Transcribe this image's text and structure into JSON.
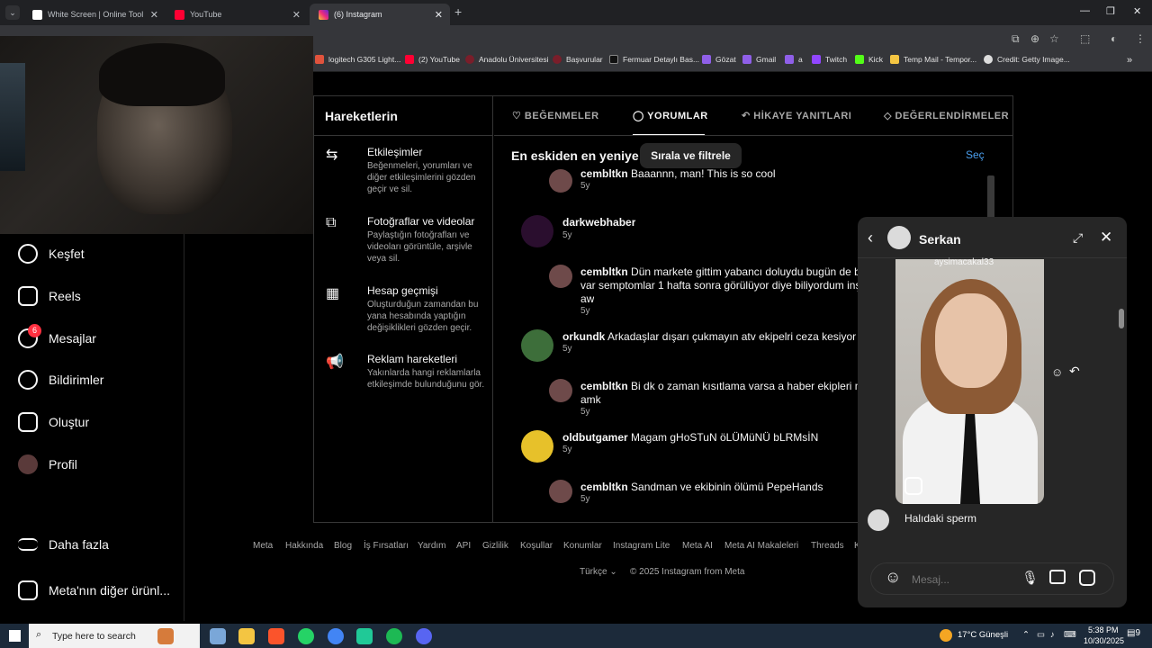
{
  "browser": {
    "tabs": [
      {
        "label": "White Screen | Online Tool",
        "active": false
      },
      {
        "label": "YouTube",
        "active": false
      },
      {
        "label": "(6) Instagram",
        "active": true
      }
    ],
    "new_tab": "+",
    "window_controls": [
      "—",
      "❐",
      "✕"
    ]
  },
  "bookmarks": [
    "logitech G305 Light...",
    "(2) YouTube",
    "Anadolu Üniversitesi",
    "Başvurular",
    "Fermuar Detaylı Bas...",
    "Gözat",
    "Gmail",
    "a",
    "Twitch",
    "Kick",
    "Temp Mail - Tempor...",
    "Credit: Getty Image..."
  ],
  "sidebar": {
    "items": [
      {
        "label": "Keşfet",
        "icon": "compass-icon"
      },
      {
        "label": "Reels",
        "icon": "reels-icon"
      },
      {
        "label": "Mesajlar",
        "icon": "messenger-icon",
        "badge": "6"
      },
      {
        "label": "Bildirimler",
        "icon": "heart-icon"
      },
      {
        "label": "Oluştur",
        "icon": "plus-square-icon"
      },
      {
        "label": "Profil",
        "icon": "avatar"
      }
    ],
    "more": "Daha fazla",
    "meta_apps": "Meta'nın diğer ürünl..."
  },
  "activity": {
    "title": "Hareketlerin",
    "menu": [
      {
        "title": "Etkileşimler",
        "desc": "Beğenmeleri, yorumları ve diğer etkileşimlerini gözden geçir ve sil."
      },
      {
        "title": "Fotoğraflar ve videolar",
        "desc": "Paylaştığın fotoğrafları ve videoları görüntüle, arşivle veya sil."
      },
      {
        "title": "Hesap geçmişi",
        "desc": "Oluşturduğun zamandan bu yana hesabında yaptığın değişiklikleri gözden geçir."
      },
      {
        "title": "Reklam hareketleri",
        "desc": "Yakınlarda hangi reklamlarla etkileşimde bulunduğunu gör."
      }
    ],
    "tabs": [
      "BEĞENMELER",
      "YORUMLAR",
      "HİKAYE YANITLARI",
      "DEĞERLENDİRMELER"
    ],
    "sort_label": "En eskiden en yeniye",
    "sort_button": "Sırala ve filtrele",
    "select_button": "Seç",
    "comments": [
      {
        "user": "cembltkn",
        "text": "Baaannn, man! This is so cool",
        "age": "5y"
      },
      {
        "user": "darkwebhaber",
        "text": "",
        "age": "5y"
      },
      {
        "user": "cembltkn",
        "text": "Dün markete gittim yabancı doluydu bugün de bu",
        "text2": "var semptomlar 1 hafta sonra görülüyor diye biliyordum inşa",
        "text3": "aw",
        "age": "5y"
      },
      {
        "user": "orkundk",
        "text": "Arkadaşlar dışarı çukmayın atv ekipelri ceza kesiyor",
        "age": "5y"
      },
      {
        "user": "cembltkn",
        "text": "Bi dk o zaman kısıtlama varsa a haber ekipleri nec",
        "text2": "amk",
        "age": "5y"
      },
      {
        "user": "oldbutgamer",
        "text": "Magam gHoSTuN öLÜMüNÜ bLRMsİN",
        "age": "5y"
      },
      {
        "user": "cembltkn",
        "text": "Sandman ve ekibinin ölümü PepeHands",
        "age": "5y"
      }
    ]
  },
  "footer": {
    "links": [
      "Meta",
      "Hakkında",
      "Blog",
      "İş Fırsatları",
      "Yardım",
      "API",
      "Gizlilik",
      "Koşullar",
      "Konumlar",
      "Instagram Lite",
      "Meta AI",
      "Meta AI Makaleleri",
      "Threads",
      "Ki"
    ],
    "language": "Türkçe",
    "copyright": "© 2025 Instagram from Meta"
  },
  "chat": {
    "name": "Serkan",
    "reel_user": "aysimacakal33",
    "message": "Halıdaki sperm",
    "input_placeholder": "Mesaj..."
  },
  "taskbar": {
    "search_placeholder": "Type here to search",
    "weather": "17°C  Güneşli",
    "time": "5:38 PM",
    "date": "10/30/2025",
    "notifications": "9"
  }
}
